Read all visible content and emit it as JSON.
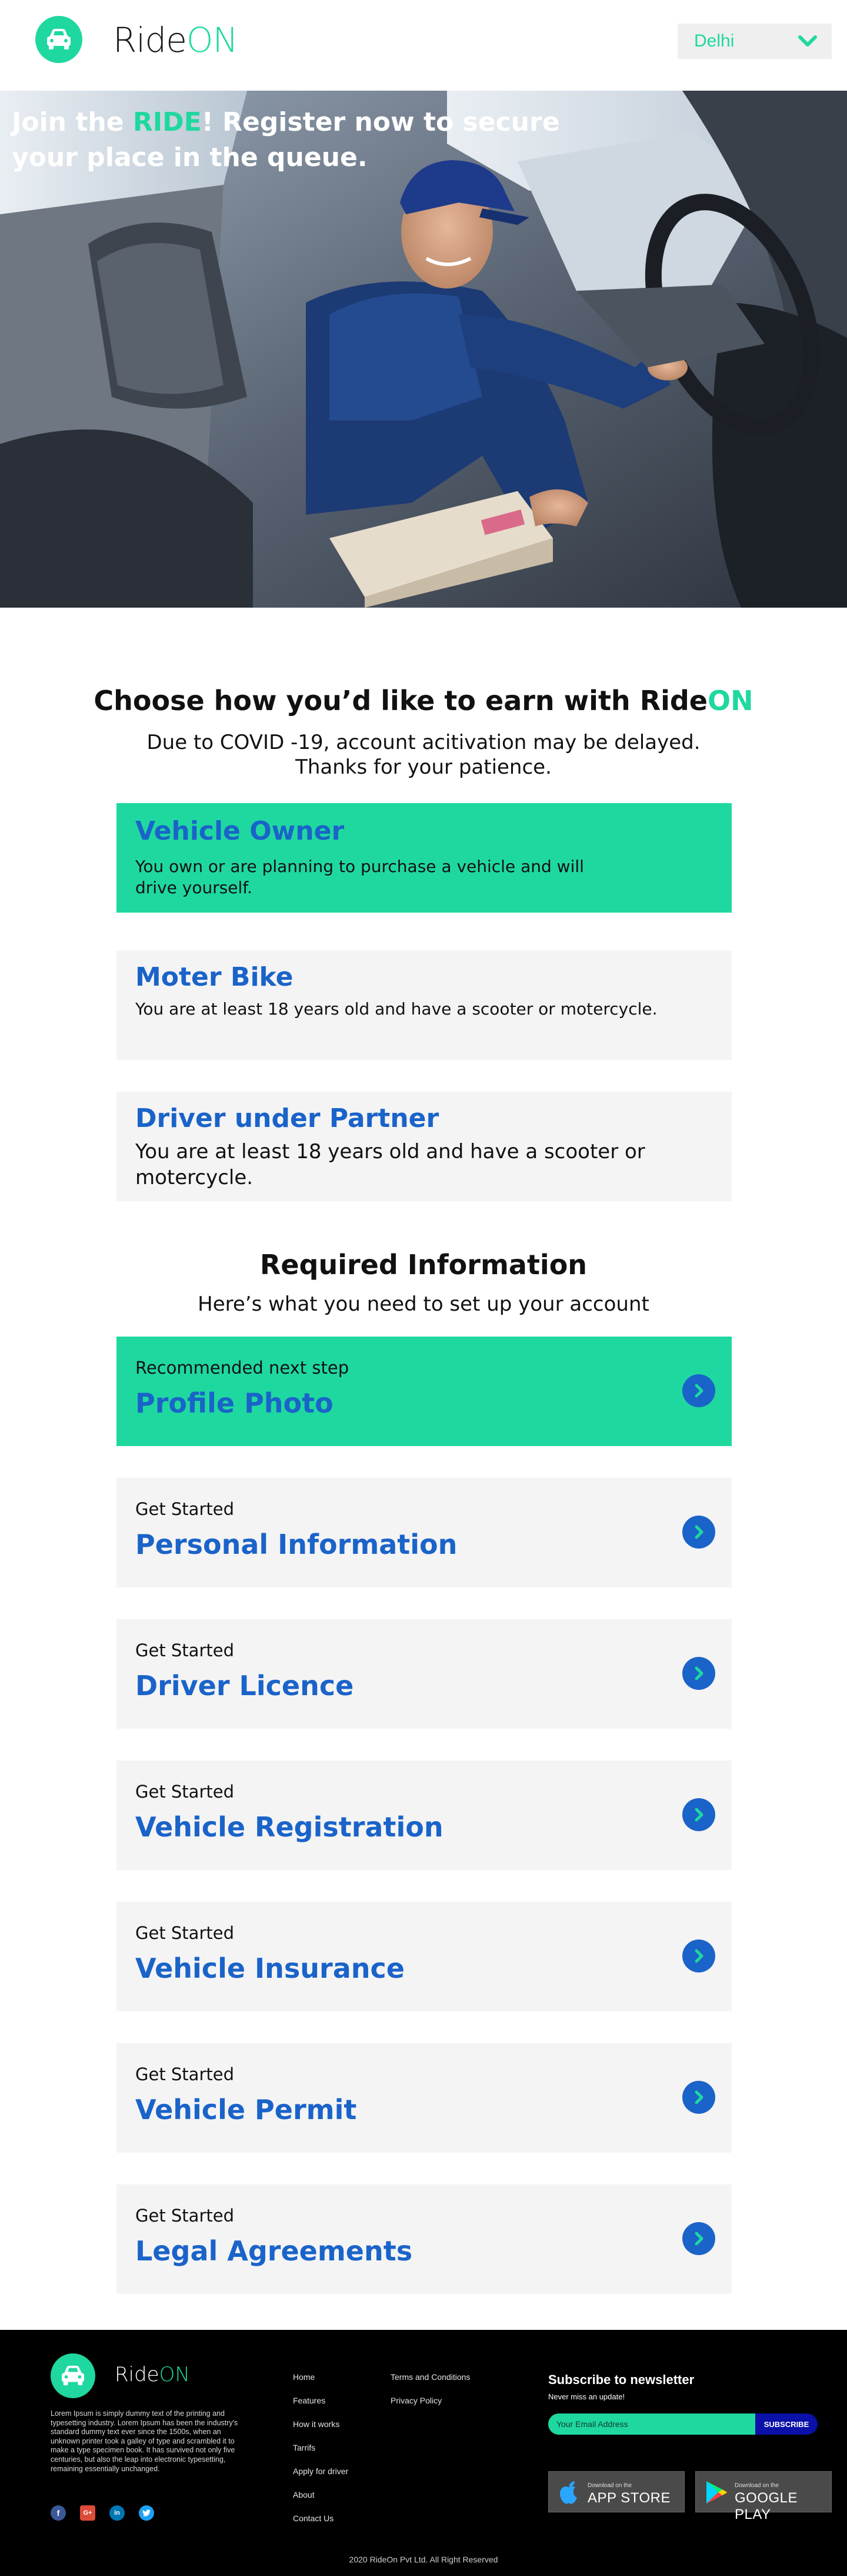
{
  "header": {
    "brand_prefix": "Ride",
    "brand_suffix": "ON",
    "city_selected": "Delhi"
  },
  "hero": {
    "title_part1": "Join the ",
    "title_accent": "RIDE",
    "title_part2": "! Register now to secure your place in the queue."
  },
  "earn": {
    "title_prefix": "Choose how you’d like to earn with Ride",
    "title_accent": "ON",
    "subtitle_line1": "Due to COVID -19, account acitivation may be delayed.",
    "subtitle_line2": "Thanks for your patience.",
    "options": [
      {
        "title": "Vehicle Owner",
        "desc": "You own or are planning to purchase a vehicle and will drive yourself."
      },
      {
        "title": "Moter Bike",
        "desc": "You are at least 18 years old and have a scooter or motercycle."
      },
      {
        "title": "Driver under Partner",
        "desc": "You are at least 18 years old and have a scooter or motercycle."
      }
    ]
  },
  "required": {
    "title": "Required Information",
    "subtitle": "Here’s what you need to set up your account",
    "steps": [
      {
        "label": "Recommended next step",
        "title": "Profile Photo"
      },
      {
        "label": "Get Started",
        "title": "Personal Information"
      },
      {
        "label": "Get Started",
        "title": "Driver Licence"
      },
      {
        "label": "Get Started",
        "title": "Vehicle Registration"
      },
      {
        "label": "Get Started",
        "title": "Vehicle Insurance"
      },
      {
        "label": "Get Started",
        "title": "Vehicle Permit"
      },
      {
        "label": "Get Started",
        "title": "Legal Agreements"
      }
    ]
  },
  "footer": {
    "brand_prefix": "Ride",
    "brand_suffix": "ON",
    "lorem": "Lorem Ipsum is simply dummy text of the printing and typesetting industry. Lorem Ipsum has been the industry's standard dummy text ever since the 1500s, when an unknown printer took a galley of type and scrambled it to make a type specimen book. It has survived not only five centuries, but also the leap into electronic typesetting, remaining essentially unchanged.",
    "links_col1": [
      "Home",
      "Features",
      "How it works",
      "Tarrifs",
      "Apply for driver",
      "About",
      "Contact Us"
    ],
    "links_col2": [
      "Terms and Conditions",
      "Privacy Policy"
    ],
    "newsletter_title": "Subscribe to newsletter",
    "newsletter_sub": "Never miss an update!",
    "email_placeholder": "Your Email Address",
    "subscribe_label": "SUBSCRIBE",
    "app_store_small": "Download on the",
    "app_store_big": "APP STORE",
    "google_play_small": "Download on the",
    "google_play_big": "GOOGLE PLAY",
    "copyright": "2020 RideOn Pvt Ltd. All Right Reserved"
  },
  "colors": {
    "accent": "#1fd8a0",
    "link_blue": "#1a63c9",
    "card_bg": "#f4f4f4"
  }
}
